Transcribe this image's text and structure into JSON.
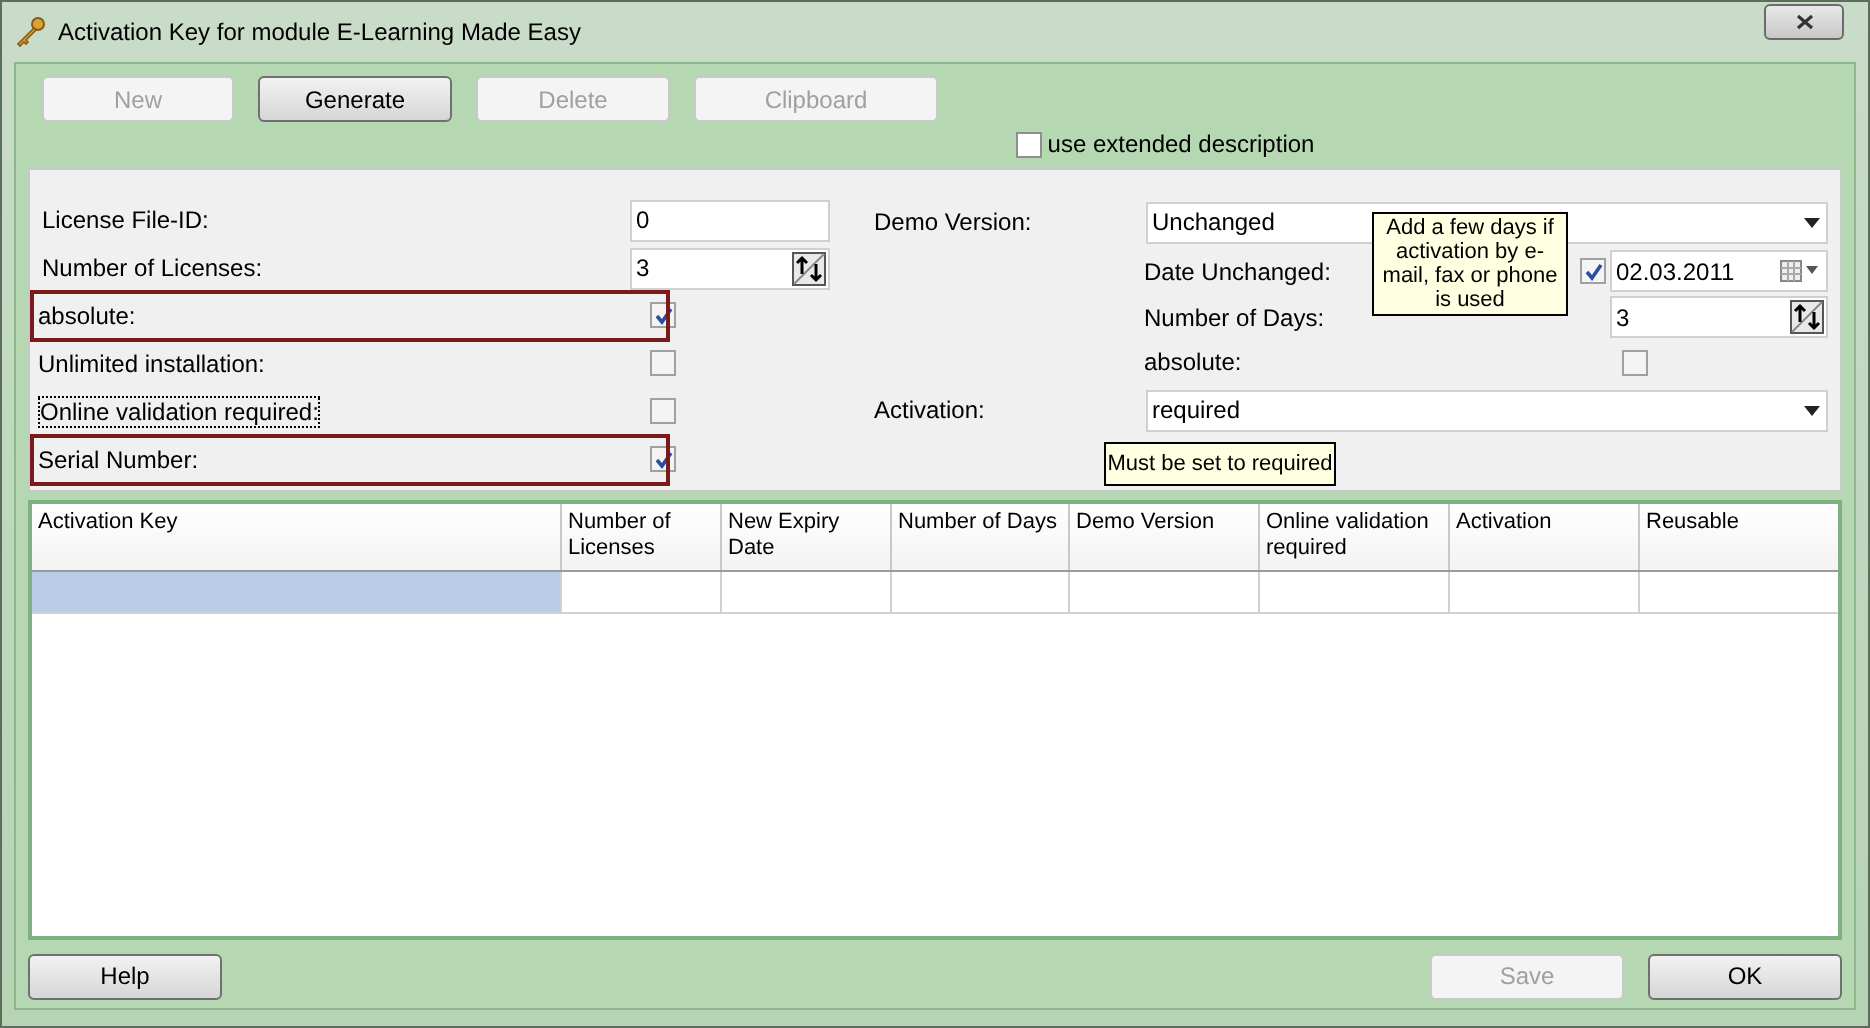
{
  "window": {
    "title": "Activation Key for module E-Learning Made Easy"
  },
  "toolbar": [
    {
      "label": "New",
      "disabled": true
    },
    {
      "label": "Generate",
      "disabled": false
    },
    {
      "label": "Delete",
      "disabled": true
    },
    {
      "label": "Clipboard",
      "disabled": true
    }
  ],
  "extended_description": {
    "label": "use extended description",
    "checked": false
  },
  "left_fields": [
    {
      "kind": "text",
      "label": "License File-ID:",
      "value": "0"
    },
    {
      "kind": "spinner",
      "label": "Number of Licenses:",
      "value": "3"
    },
    {
      "kind": "checkbox",
      "label": "absolute:",
      "checked": true,
      "highlighted": true,
      "focused": false
    },
    {
      "kind": "checkbox",
      "label": "Unlimited installation:",
      "checked": false,
      "highlighted": false,
      "focused": false
    },
    {
      "kind": "checkbox",
      "label": "Online validation required:",
      "checked": false,
      "highlighted": false,
      "focused": true
    },
    {
      "kind": "checkbox",
      "label": "Serial Number:",
      "checked": true,
      "highlighted": true,
      "focused": false
    }
  ],
  "right_fields": [
    {
      "kind": "dropdown",
      "label": "Demo Version:",
      "value": "Unchanged"
    },
    {
      "kind": "date",
      "label": "Date Unchanged:",
      "checked": true,
      "value": "02.03.2011"
    },
    {
      "kind": "spinner",
      "label": "Number of Days:",
      "value": "3"
    },
    {
      "kind": "checkbox",
      "label": "absolute:",
      "checked": false
    },
    {
      "kind": "dropdown",
      "label": "Activation:",
      "value": "required"
    }
  ],
  "callouts": [
    "Add a few days if activation by e-mail, fax or phone is used",
    "Must be set to required"
  ],
  "table": {
    "columns": [
      "Activation Key",
      "Number of Licenses",
      "New Expiry Date",
      "Number of Days",
      "Demo Version",
      "Online validation required",
      "Activation",
      "Reusable"
    ],
    "rows": [
      {
        "selected": true
      }
    ]
  },
  "footer": [
    {
      "label": "Help",
      "disabled": false
    },
    {
      "label": "Save",
      "disabled": true
    },
    {
      "label": "OK",
      "disabled": false
    }
  ]
}
